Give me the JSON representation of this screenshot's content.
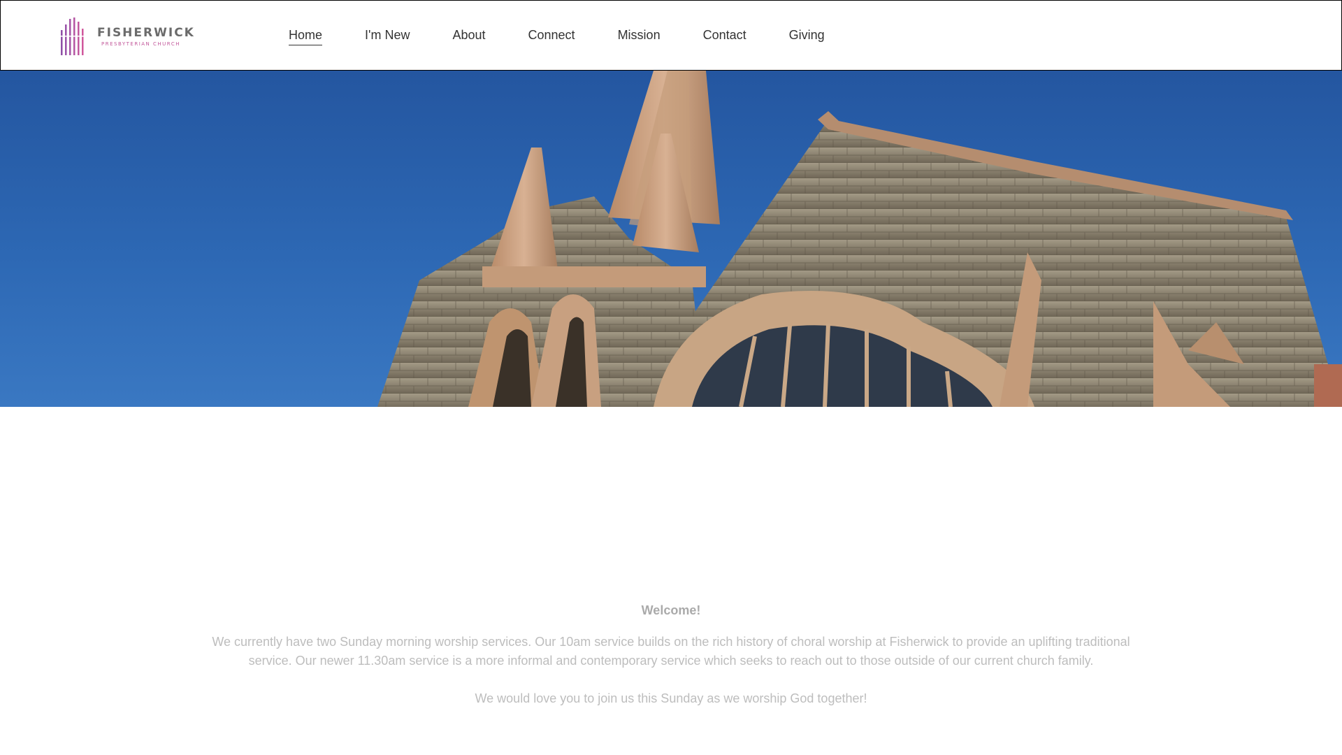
{
  "header": {
    "logo": {
      "name": "FISHERWICK",
      "subtitle": "Presbyterian Church",
      "icon": "organ-pipes-icon",
      "colors": {
        "purple": "#8e4fa6",
        "pink": "#d0589c"
      }
    },
    "nav": [
      {
        "label": "Home",
        "active": true
      },
      {
        "label": "I'm New",
        "active": false
      },
      {
        "label": "About",
        "active": false
      },
      {
        "label": "Connect",
        "active": false
      },
      {
        "label": "Mission",
        "active": false
      },
      {
        "label": "Contact",
        "active": false
      },
      {
        "label": "Giving",
        "active": false
      }
    ]
  },
  "hero": {
    "sky_color": "#2a62ae",
    "stone_color": "#8f8570",
    "sandstone_color": "#c9a07e"
  },
  "content": {
    "heading": "Welcome!",
    "paragraph1": "We currently have two Sunday morning worship services. Our 10am service builds on the rich history of choral worship at Fisherwick to provide an uplifting traditional service. Our newer 11.30am service is a more informal and contemporary service which seeks to reach out to those outside of our current church family.",
    "paragraph2": "We would love you to join us this Sunday as we worship God together!"
  }
}
